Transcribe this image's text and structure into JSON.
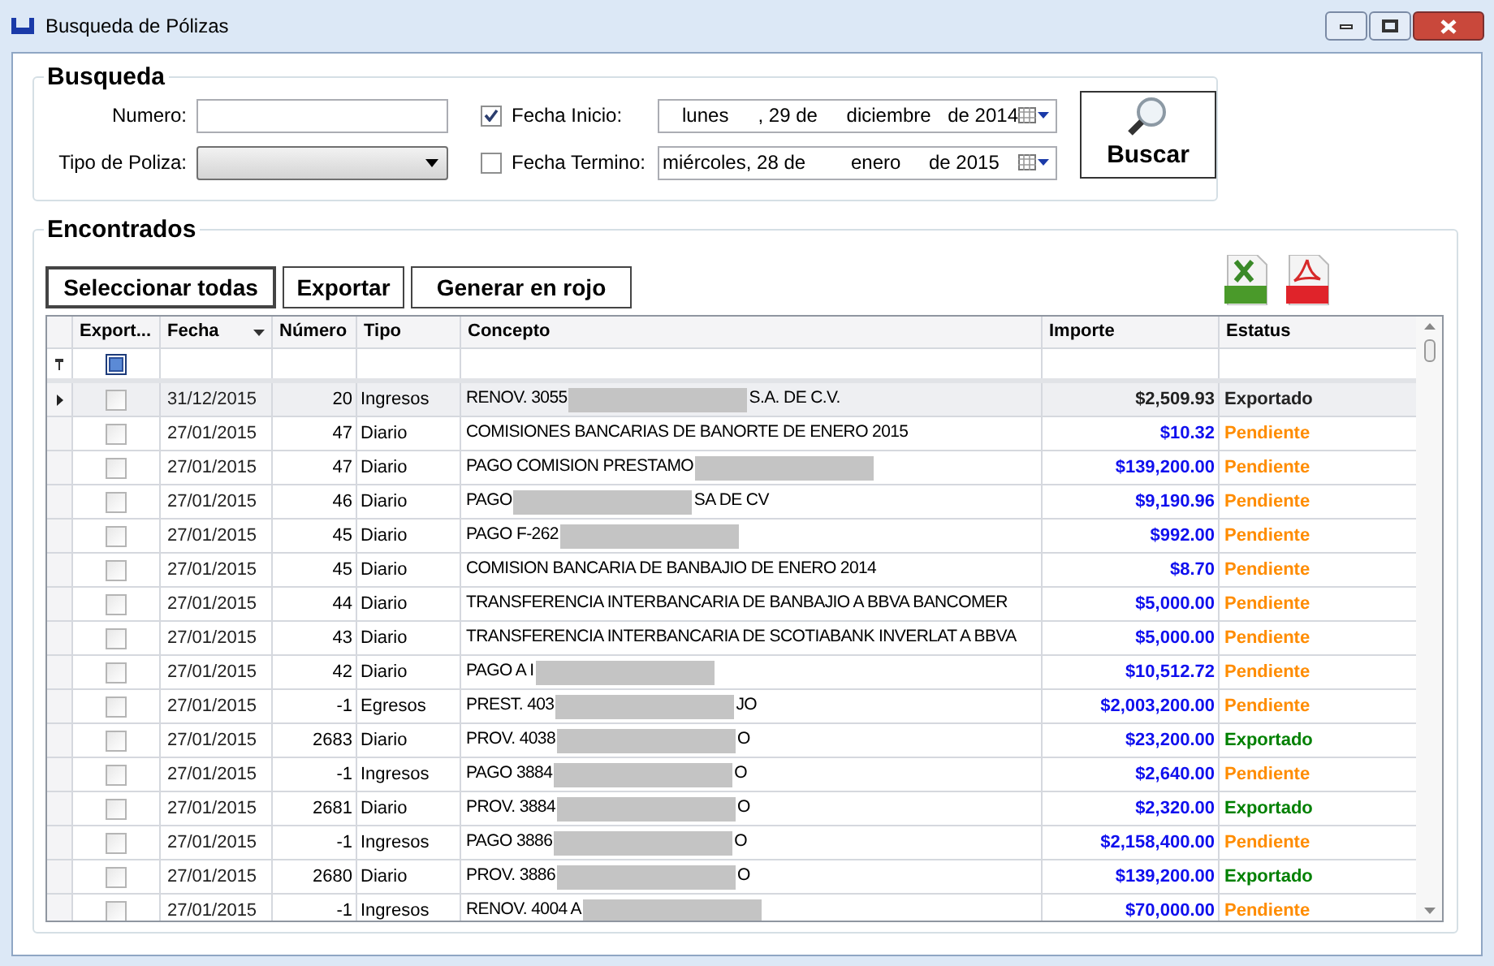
{
  "window": {
    "title": "Busqueda de Pólizas"
  },
  "search": {
    "title": "Busqueda",
    "numero_label": "Numero:",
    "tipo_label": "Tipo de Poliza:",
    "fecha_inicio": {
      "label": "Fecha Inicio:",
      "checked": true,
      "weekday": "lunes",
      "day": ", 29 de",
      "month": "diciembre",
      "year": "de 2014"
    },
    "fecha_termino": {
      "label": "Fecha Termino:",
      "checked": false,
      "weekday": "miércoles, 28 de",
      "month": "enero",
      "year": "de 2015"
    },
    "button": "Buscar"
  },
  "results": {
    "title": "Encontrados",
    "buttons": [
      "Seleccionar todas",
      "Exportar",
      "Generar en rojo"
    ],
    "columns": [
      "Export...",
      "Fecha",
      "Número",
      "Tipo",
      "Concepto",
      "Importe",
      "Estatus"
    ],
    "filter_checked": true,
    "rows": [
      {
        "selected": true,
        "checked": false,
        "fecha": "31/12/2015",
        "numero": "20",
        "tipo": "Ingresos",
        "concepto": [
          {
            "kind": "text",
            "text": "RENOV. 3055"
          },
          {
            "kind": "redacted"
          },
          {
            "kind": "text",
            "text": "S.A. DE C.V."
          }
        ],
        "importe": "$2,509.93",
        "estatus": "Exportado",
        "color": "#222222"
      },
      {
        "selected": false,
        "checked": false,
        "fecha": "27/01/2015",
        "numero": "47",
        "tipo": "Diario",
        "concepto": [
          {
            "kind": "text",
            "text": "COMISIONES BANCARIAS DE BANORTE DE ENERO 2015"
          }
        ],
        "importe": "$10.32",
        "estatus": "Pendiente",
        "color": "#ff8c00"
      },
      {
        "selected": false,
        "checked": false,
        "fecha": "27/01/2015",
        "numero": "47",
        "tipo": "Diario",
        "concepto": [
          {
            "kind": "text",
            "text": "PAGO COMISION PRESTAMO"
          },
          {
            "kind": "redacted"
          }
        ],
        "importe": "$139,200.00",
        "estatus": "Pendiente",
        "color": "#ff8c00"
      },
      {
        "selected": false,
        "checked": false,
        "fecha": "27/01/2015",
        "numero": "46",
        "tipo": "Diario",
        "concepto": [
          {
            "kind": "text",
            "text": "PAGO"
          },
          {
            "kind": "redacted"
          },
          {
            "kind": "text",
            "text": "SA DE CV"
          }
        ],
        "importe": "$9,190.96",
        "estatus": "Pendiente",
        "color": "#ff8c00"
      },
      {
        "selected": false,
        "checked": false,
        "fecha": "27/01/2015",
        "numero": "45",
        "tipo": "Diario",
        "concepto": [
          {
            "kind": "text",
            "text": "PAGO F-262"
          },
          {
            "kind": "redacted"
          }
        ],
        "importe": "$992.00",
        "estatus": "Pendiente",
        "color": "#ff8c00"
      },
      {
        "selected": false,
        "checked": false,
        "fecha": "27/01/2015",
        "numero": "45",
        "tipo": "Diario",
        "concepto": [
          {
            "kind": "text",
            "text": "COMISION BANCARIA DE BANBAJIO DE ENERO 2014"
          }
        ],
        "importe": "$8.70",
        "estatus": "Pendiente",
        "color": "#ff8c00"
      },
      {
        "selected": false,
        "checked": false,
        "fecha": "27/01/2015",
        "numero": "44",
        "tipo": "Diario",
        "concepto": [
          {
            "kind": "text",
            "text": "TRANSFERENCIA INTERBANCARIA DE BANBAJIO A BBVA BANCOMER"
          }
        ],
        "importe": "$5,000.00",
        "estatus": "Pendiente",
        "color": "#ff8c00"
      },
      {
        "selected": false,
        "checked": false,
        "fecha": "27/01/2015",
        "numero": "43",
        "tipo": "Diario",
        "concepto": [
          {
            "kind": "text",
            "text": "TRANSFERENCIA INTERBANCARIA DE SCOTIABANK INVERLAT A BBVA"
          }
        ],
        "importe": "$5,000.00",
        "estatus": "Pendiente",
        "color": "#ff8c00"
      },
      {
        "selected": false,
        "checked": false,
        "fecha": "27/01/2015",
        "numero": "42",
        "tipo": "Diario",
        "concepto": [
          {
            "kind": "text",
            "text": "PAGO A I"
          },
          {
            "kind": "redacted"
          }
        ],
        "importe": "$10,512.72",
        "estatus": "Pendiente",
        "color": "#ff8c00"
      },
      {
        "selected": false,
        "checked": false,
        "fecha": "27/01/2015",
        "numero": "-1",
        "tipo": "Egresos",
        "concepto": [
          {
            "kind": "text",
            "text": "PREST. 403"
          },
          {
            "kind": "redacted"
          },
          {
            "kind": "text",
            "text": "JO"
          }
        ],
        "importe": "$2,003,200.00",
        "estatus": "Pendiente",
        "color": "#ff8c00"
      },
      {
        "selected": false,
        "checked": false,
        "fecha": "27/01/2015",
        "numero": "2683",
        "tipo": "Diario",
        "concepto": [
          {
            "kind": "text",
            "text": "PROV. 4038"
          },
          {
            "kind": "redacted"
          },
          {
            "kind": "text",
            "text": "O"
          }
        ],
        "importe": "$23,200.00",
        "estatus": "Exportado",
        "color": "#008000"
      },
      {
        "selected": false,
        "checked": false,
        "fecha": "27/01/2015",
        "numero": "-1",
        "tipo": "Ingresos",
        "concepto": [
          {
            "kind": "text",
            "text": "PAGO 3884"
          },
          {
            "kind": "redacted"
          },
          {
            "kind": "text",
            "text": "O"
          }
        ],
        "importe": "$2,640.00",
        "estatus": "Pendiente",
        "color": "#ff8c00"
      },
      {
        "selected": false,
        "checked": false,
        "fecha": "27/01/2015",
        "numero": "2681",
        "tipo": "Diario",
        "concepto": [
          {
            "kind": "text",
            "text": "PROV. 3884"
          },
          {
            "kind": "redacted"
          },
          {
            "kind": "text",
            "text": "O"
          }
        ],
        "importe": "$2,320.00",
        "estatus": "Exportado",
        "color": "#008000"
      },
      {
        "selected": false,
        "checked": false,
        "fecha": "27/01/2015",
        "numero": "-1",
        "tipo": "Ingresos",
        "concepto": [
          {
            "kind": "text",
            "text": "PAGO 3886"
          },
          {
            "kind": "redacted"
          },
          {
            "kind": "text",
            "text": "O"
          }
        ],
        "importe": "$2,158,400.00",
        "estatus": "Pendiente",
        "color": "#ff8c00"
      },
      {
        "selected": false,
        "checked": false,
        "fecha": "27/01/2015",
        "numero": "2680",
        "tipo": "Diario",
        "concepto": [
          {
            "kind": "text",
            "text": "PROV. 3886"
          },
          {
            "kind": "redacted"
          },
          {
            "kind": "text",
            "text": "O"
          }
        ],
        "importe": "$139,200.00",
        "estatus": "Exportado",
        "color": "#008000"
      },
      {
        "selected": false,
        "checked": false,
        "fecha": "27/01/2015",
        "numero": "-1",
        "tipo": "Ingresos",
        "concepto": [
          {
            "kind": "text",
            "text": "RENOV. 4004 A"
          },
          {
            "kind": "redacted"
          }
        ],
        "importe": "$70,000.00",
        "estatus": "Pendiente",
        "color": "#ff8c00"
      }
    ]
  }
}
